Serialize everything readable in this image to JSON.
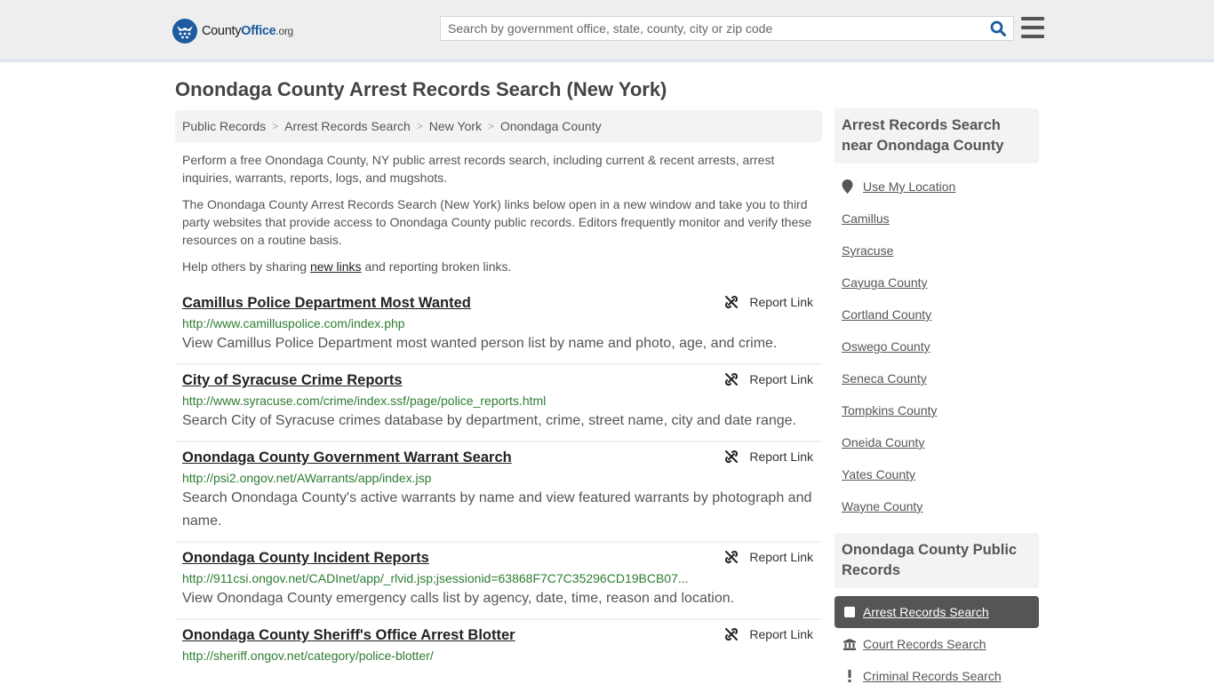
{
  "header": {
    "logo": {
      "county": "County",
      "office": "Office",
      "tld": ".org",
      "icon": "eagle-stars-logo"
    },
    "search": {
      "placeholder": "Search by government office, state, county, city or zip code",
      "value": "",
      "icon": "search-icon"
    },
    "menu_icon": "hamburger-menu-icon"
  },
  "page": {
    "title": "Onondaga County Arrest Records Search (New York)",
    "breadcrumb": [
      "Public Records",
      "Arrest Records Search",
      "New York",
      "Onondaga County"
    ],
    "intro": {
      "p1": "Perform a free Onondaga County, NY public arrest records search, including current & recent arrests, arrest inquiries, warrants, reports, logs, and mugshots.",
      "p2": "The Onondaga County Arrest Records Search (New York) links below open in a new window and take you to third party websites that provide access to Onondaga County public records. Editors frequently monitor and verify these resources on a routine basis.",
      "p3_before": "Help others by sharing ",
      "p3_link": "new links",
      "p3_after": " and reporting broken links."
    }
  },
  "results": [
    {
      "title": "Camillus Police Department Most Wanted",
      "url": "http://www.camilluspolice.com/index.php",
      "description": "View Camillus Police Department most wanted person list by name and photo, age, and crime.",
      "report_label": "Report Link"
    },
    {
      "title": "City of Syracuse Crime Reports",
      "url": "http://www.syracuse.com/crime/index.ssf/page/police_reports.html",
      "description": "Search City of Syracuse crimes database by department, crime, street name, city and date range.",
      "report_label": "Report Link"
    },
    {
      "title": "Onondaga County Government Warrant Search",
      "url": "http://psi2.ongov.net/AWarrants/app/index.jsp",
      "description": "Search Onondaga County's active warrants by name and view featured warrants by photograph and name.",
      "report_label": "Report Link"
    },
    {
      "title": "Onondaga County Incident Reports",
      "url": "http://911csi.ongov.net/CADInet/app/_rlvid.jsp;jsessionid=63868F7C7C35296CD19BCB07...",
      "description": "View Onondaga County emergency calls list by agency, date, time, reason and location.",
      "report_label": "Report Link"
    },
    {
      "title": "Onondaga County Sheriff's Office Arrest Blotter",
      "url": "http://sheriff.ongov.net/category/police-blotter/",
      "description": "",
      "report_label": "Report Link"
    }
  ],
  "sidebar": {
    "nearby_heading": "Arrest Records Search near Onondaga County",
    "use_location": "Use My Location",
    "nearby": [
      "Camillus",
      "Syracuse",
      "Cayuga County",
      "Cortland County",
      "Oswego County",
      "Seneca County",
      "Tompkins County",
      "Oneida County",
      "Yates County",
      "Wayne County"
    ],
    "public_records_heading": "Onondaga County Public Records",
    "categories": [
      {
        "label": "Arrest Records Search",
        "icon": "arrest-square-icon",
        "active": true
      },
      {
        "label": "Court Records Search",
        "icon": "courthouse-icon",
        "active": false
      },
      {
        "label": "Criminal Records Search",
        "icon": "exclamation-icon",
        "active": false
      }
    ]
  },
  "colors": {
    "brand_blue": "#1d5b9e",
    "header_border": "#3a7caa",
    "url_green": "#2e7d32",
    "active_category_bg": "#555555"
  }
}
